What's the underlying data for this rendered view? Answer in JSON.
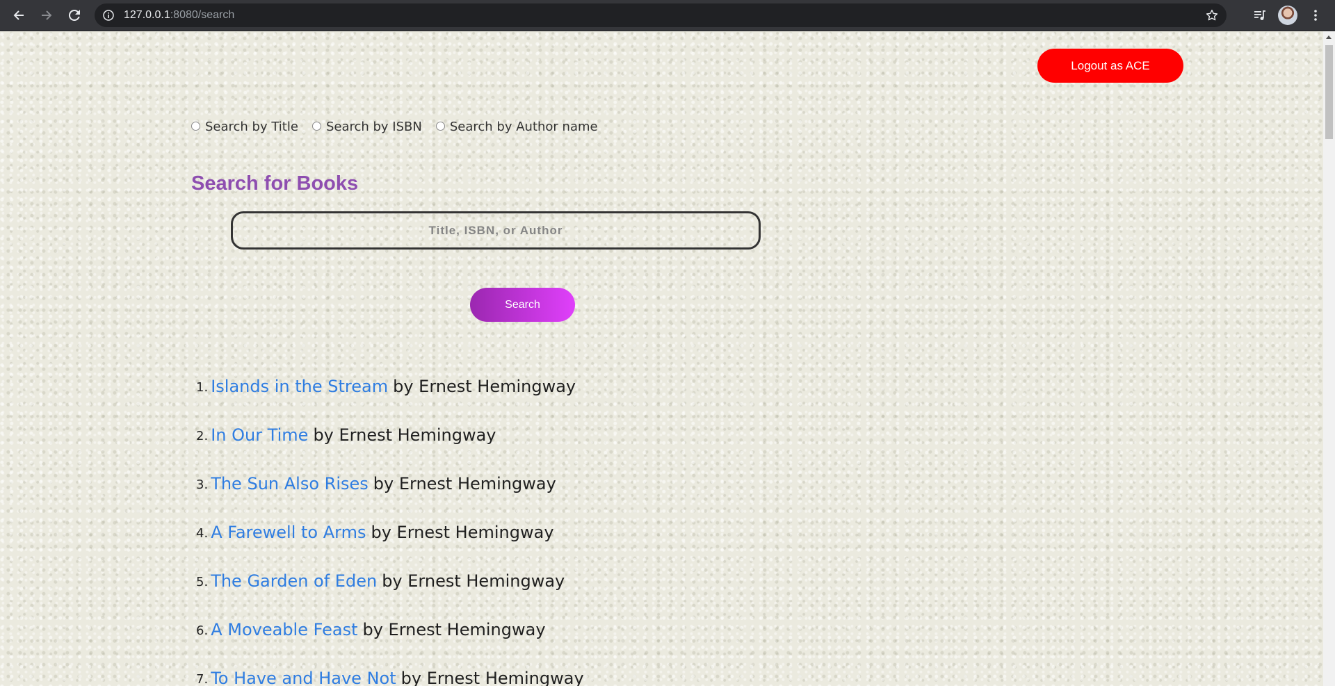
{
  "browser": {
    "url_host": "127.0.0.1",
    "url_rest": ":8080/search",
    "icons": {
      "back": "back-arrow-icon",
      "forward": "forward-arrow-icon",
      "reload": "reload-icon",
      "info": "site-info-icon",
      "bookmark": "bookmark-star-icon",
      "media": "media-queue-icon",
      "menu": "kebab-menu-icon"
    }
  },
  "header": {
    "logout_label": "Logout as ACE",
    "logout_color": "#ff0000"
  },
  "search_mode": {
    "options": [
      {
        "label": "Search by Title"
      },
      {
        "label": "Search by ISBN"
      },
      {
        "label": "Search by Author name"
      }
    ]
  },
  "search": {
    "heading": "Search for Books",
    "placeholder": "Title, ISBN, or Author",
    "value": "",
    "button_label": "Search",
    "accent_color": "#8e4eb0"
  },
  "results": {
    "link_color": "#2f7de1",
    "items": [
      {
        "num": "1.",
        "title": "Islands in the Stream",
        "by": "by Ernest Hemingway"
      },
      {
        "num": "2.",
        "title": "In Our Time",
        "by": "by Ernest Hemingway"
      },
      {
        "num": "3.",
        "title": "The Sun Also Rises",
        "by": "by Ernest Hemingway"
      },
      {
        "num": "4.",
        "title": "A Farewell to Arms",
        "by": "by Ernest Hemingway"
      },
      {
        "num": "5.",
        "title": "The Garden of Eden",
        "by": "by Ernest Hemingway"
      },
      {
        "num": "6.",
        "title": "A Moveable Feast",
        "by": "by Ernest Hemingway"
      },
      {
        "num": "7.",
        "title": "To Have and Have Not",
        "by": "by Ernest Hemingway"
      }
    ]
  }
}
